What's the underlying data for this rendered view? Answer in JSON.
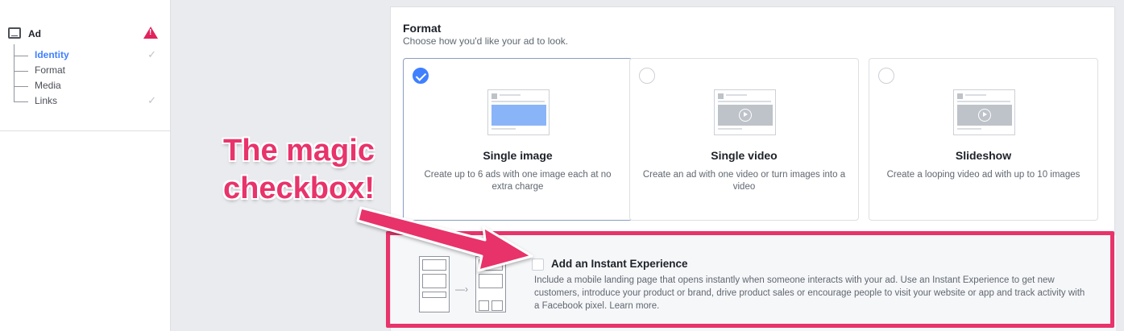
{
  "sidebar": {
    "section_label": "Ad",
    "items": [
      {
        "label": "Identity",
        "active": true,
        "checked": true
      },
      {
        "label": "Format",
        "active": false,
        "checked": false
      },
      {
        "label": "Media",
        "active": false,
        "checked": false
      },
      {
        "label": "Links",
        "active": false,
        "checked": true
      }
    ],
    "warning_icon": "warning-triangle-icon",
    "check_icon": "check-icon"
  },
  "format": {
    "title": "Format",
    "subtitle": "Choose how you'd like your ad to look.",
    "options": [
      {
        "title": "Single image",
        "description": "Create up to 6 ads with one image each at no extra charge",
        "selected": true
      },
      {
        "title": "Single video",
        "description": "Create an ad with one video or turn images into a video",
        "selected": false
      },
      {
        "title": "Slideshow",
        "description": "Create a looping video ad with up to 10 images",
        "selected": false
      }
    ]
  },
  "instant_experience": {
    "title": "Add an Instant Experience",
    "description": "Include a mobile landing page that opens instantly when someone interacts with your ad. Use an Instant Experience to get new customers, introduce your product or brand, drive product sales or encourage people to visit your website or app and track activity with a Facebook pixel.",
    "learn_more": "Learn more.",
    "checked": false
  },
  "annotation": {
    "line1": "The magic",
    "line2": "checkbox!",
    "color": "#e8336b"
  },
  "colors": {
    "accent": "#4080ff",
    "warning": "#e0245e",
    "annotation": "#e8336b"
  }
}
